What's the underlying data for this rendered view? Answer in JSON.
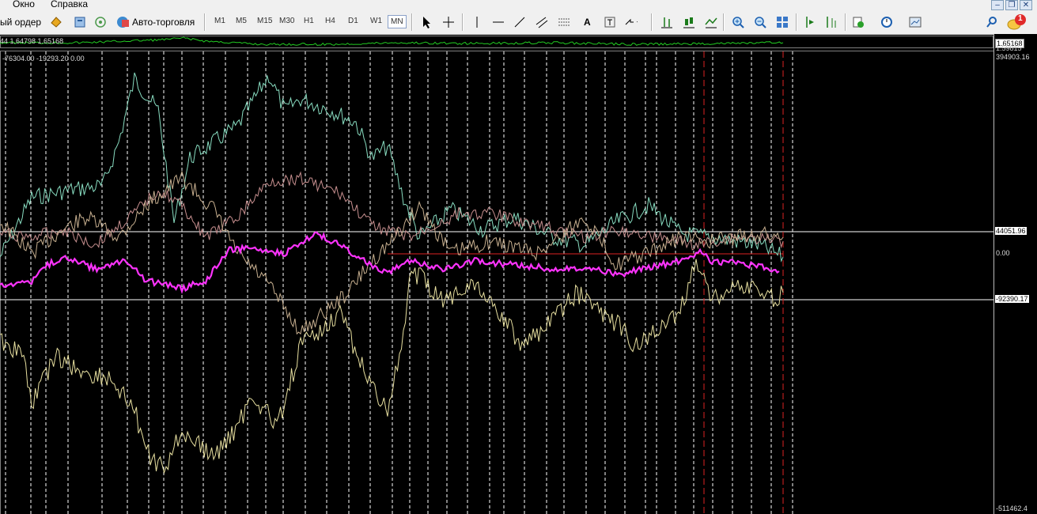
{
  "menu": {
    "items": [
      "Окно",
      "Справка"
    ]
  },
  "toolbar": {
    "new_order_label": "ый ордер",
    "autotrade_label": "Авто-торговля",
    "timeframes": [
      "M1",
      "M5",
      "M15",
      "M30",
      "H1",
      "H4",
      "D1",
      "W1",
      "MN"
    ],
    "active_timeframe": "MN",
    "text_tool_label": "A",
    "notification_count": "1"
  },
  "top_panel": {
    "info_text": "44 1.64798 1.65168",
    "price_label": "1.65168",
    "price_label2": "1.59815"
  },
  "main_panel": {
    "info_text": "-76304.00 -19293.20 0.00",
    "scale": {
      "top": "394903.16",
      "upper_level": "44051.96",
      "zero": "0.00",
      "lower_level": "-92390.17",
      "bottom": "-511462.4"
    }
  },
  "colors": {
    "background": "#000000",
    "grid": "#ffffff",
    "magenta_line": "#ff33ff",
    "red_vline": "#dd2222",
    "top_indicator": "#22cc22",
    "aqua_line": "#88dcc0",
    "yellow_line": "#e8e0a0",
    "tan_line": "#c8b090",
    "pink_line": "#c89090"
  }
}
